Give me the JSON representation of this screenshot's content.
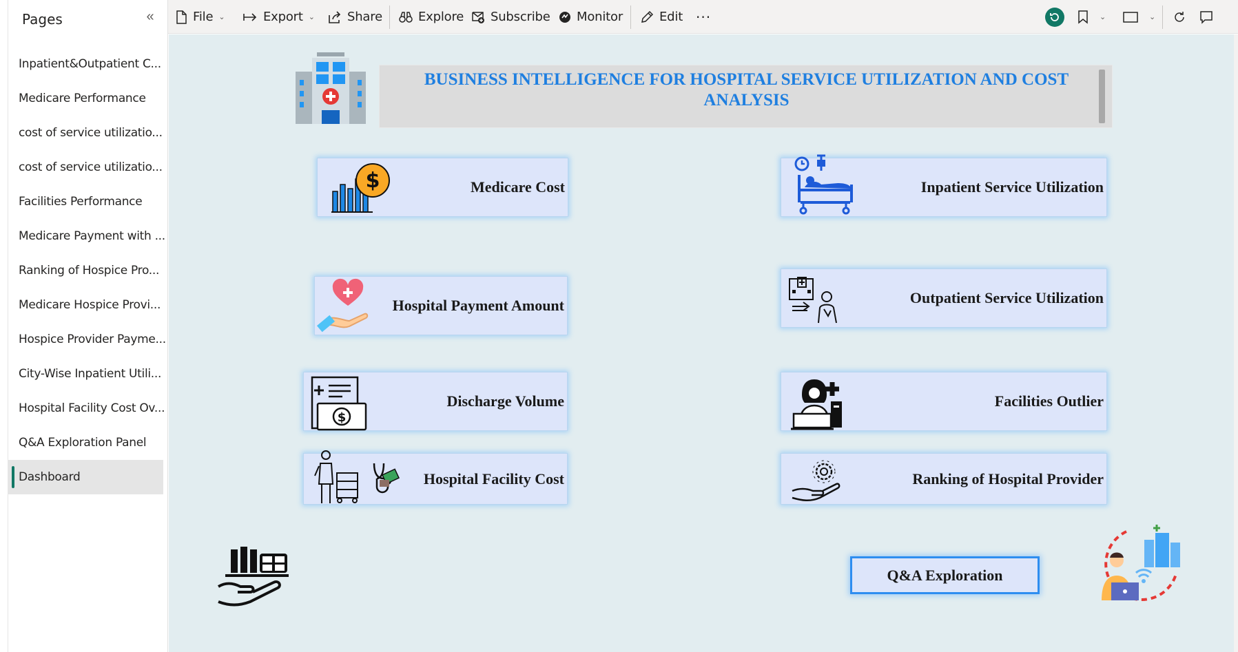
{
  "sidebar": {
    "title": "Pages",
    "collapse_icon": "double-chevron-left-icon",
    "items": [
      {
        "label": "Inpatient&Outpatient C..."
      },
      {
        "label": "Medicare Performance"
      },
      {
        "label": "cost of service utilizatio..."
      },
      {
        "label": "cost of service utilizatio..."
      },
      {
        "label": "Facilities Performance"
      },
      {
        "label": "Medicare Payment with ..."
      },
      {
        "label": "Ranking of Hospice Pro..."
      },
      {
        "label": "Medicare Hospice Provi..."
      },
      {
        "label": "Hospice Provider Payme..."
      },
      {
        "label": "City-Wise Inpatient Utili..."
      },
      {
        "label": "Hospital Facility Cost Ov..."
      },
      {
        "label": "Q&A Exploration Panel"
      },
      {
        "label": "Dashboard",
        "active": true
      }
    ]
  },
  "toolbar": {
    "file": "File",
    "export": "Export",
    "share": "Share",
    "explore": "Explore",
    "subscribe": "Subscribe",
    "monitor": "Monitor",
    "edit": "Edit",
    "more": "···",
    "accent_color": "#117865"
  },
  "report": {
    "title": "BUSINESS INTELLIGENCE FOR HOSPITAL SERVICE UTILIZATION AND COST ANALYSIS",
    "title_color": "#1f7fe0",
    "cards": {
      "medicare_cost": "Medicare Cost",
      "inpatient_util": "Inpatient Service Utilization",
      "hospital_payment": "Hospital Payment Amount",
      "outpatient_util": "Outpatient Service Utilization",
      "discharge_volume": "Discharge Volume",
      "facilities_outlier": "Facilities Outlier",
      "facility_cost": "Hospital Facility Cost",
      "ranking_provider": "Ranking of Hospital Provider"
    },
    "qa_button": "Q&A Exploration"
  }
}
